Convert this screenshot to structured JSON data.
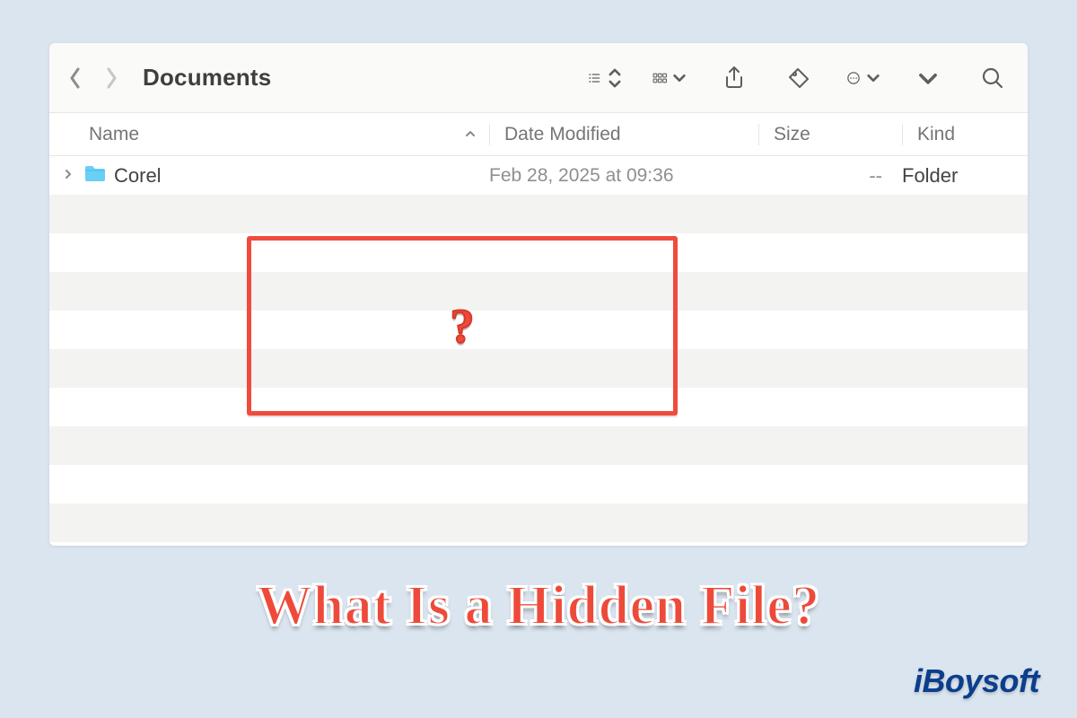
{
  "window": {
    "title": "Documents"
  },
  "columns": {
    "name": "Name",
    "date": "Date Modified",
    "size": "Size",
    "kind": "Kind"
  },
  "rows": [
    {
      "name": "Corel",
      "date": "Feb 28, 2025 at 09:36",
      "size": "--",
      "kind": "Folder"
    }
  ],
  "overlay": {
    "question_mark": "?",
    "headline": "What Is a Hidden File?"
  },
  "brand": "iBoysoft"
}
